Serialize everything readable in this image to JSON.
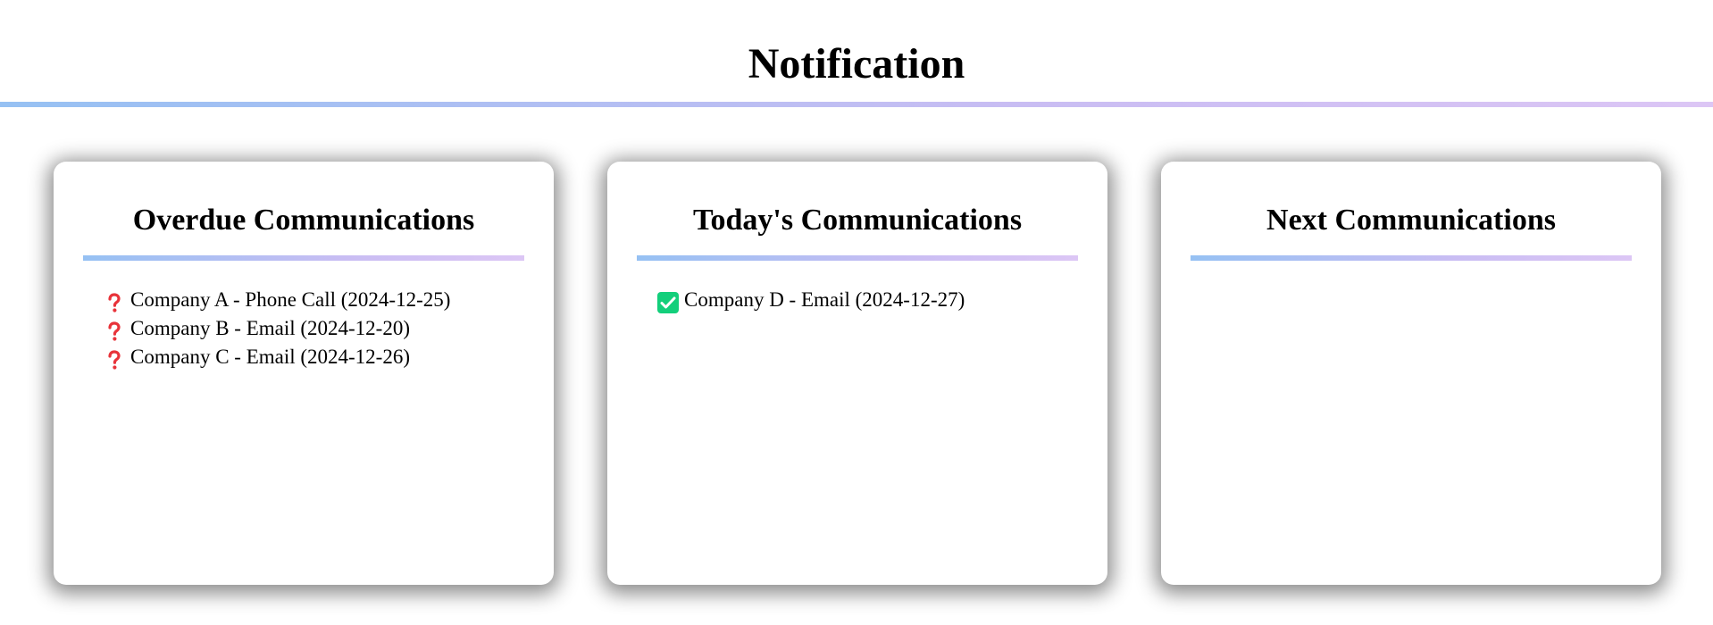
{
  "header": {
    "title": "Notification"
  },
  "colors": {
    "rule_start": "#96c1f3",
    "rule_end": "#dcc6f5",
    "overdue_icon": "#e8333a",
    "today_icon": "#13cf7b"
  },
  "cards": [
    {
      "title": "Overdue Communications",
      "icon": "question-mark-icon",
      "items": [
        {
          "text": "Company A - Phone Call (2024-12-25)"
        },
        {
          "text": "Company B - Email (2024-12-20)"
        },
        {
          "text": "Company C - Email (2024-12-26)"
        }
      ]
    },
    {
      "title": "Today's Communications",
      "icon": "checkmark-icon",
      "items": [
        {
          "text": "Company D - Email (2024-12-27)"
        }
      ]
    },
    {
      "title": "Next Communications",
      "icon": "",
      "items": []
    }
  ]
}
